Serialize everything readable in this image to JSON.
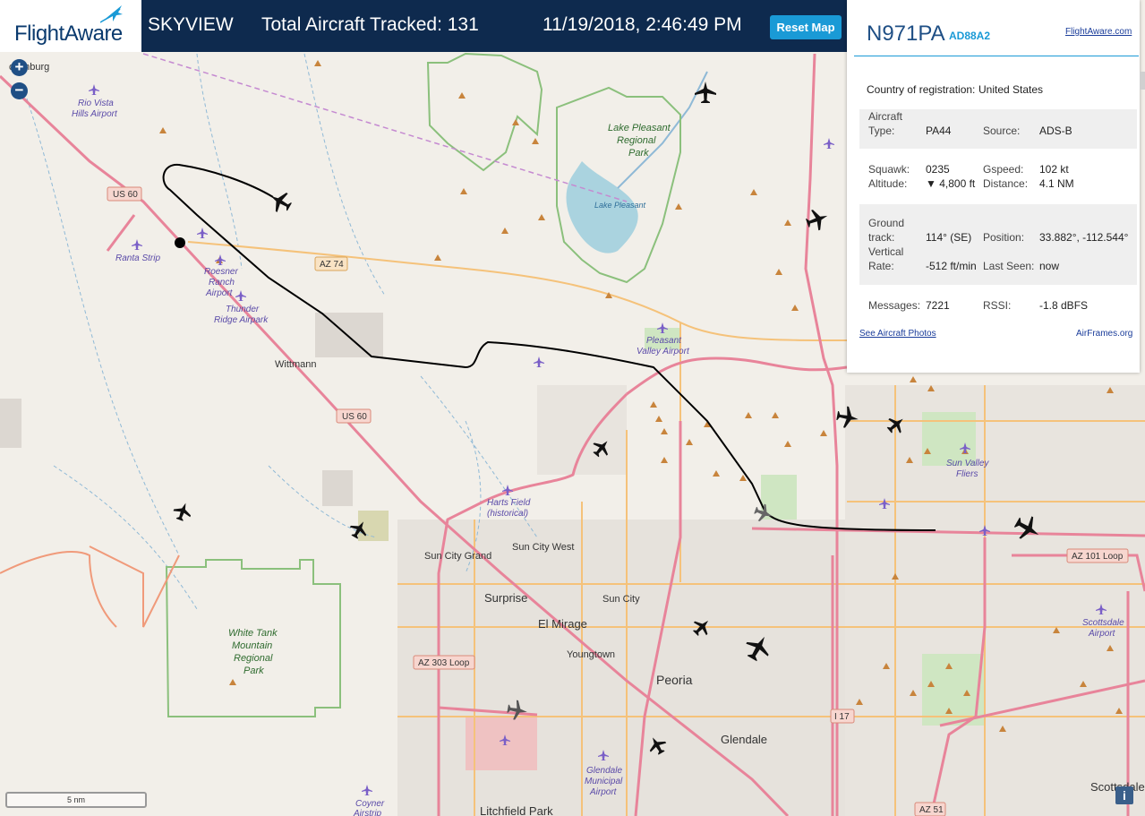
{
  "header": {
    "brand": "FlightAware",
    "app_name": "SKYVIEW",
    "tracked_label": "Total Aircraft Tracked: 131",
    "datetime": "11/19/2018, 2:46:49 PM",
    "reset_label": "Reset Map"
  },
  "map_controls": {
    "zoom_in": "+",
    "zoom_out": "−",
    "scale": "5 nm",
    "info": "i"
  },
  "aircraft": {
    "ident": "N971PA",
    "hex": "AD88A2",
    "flightaware_link": "FlightAware.com",
    "country_label": "Country of registration:",
    "country": "United States",
    "type_label_1": "Aircraft",
    "type_label_2": "Type:",
    "type": "PA44",
    "source_label": "Source:",
    "source": "ADS-B",
    "squawk_label": "Squawk:",
    "squawk": "0235",
    "gspeed_label": "Gspeed:",
    "gspeed": "102 kt",
    "altitude_label": "Altitude:",
    "altitude": "▼ 4,800 ft",
    "distance_label": "Distance:",
    "distance": "4.1 NM",
    "track_label_1": "Ground",
    "track_label_2": "track:",
    "track": "114° (SE)",
    "position_label": "Position:",
    "position": "33.882°, -112.544°",
    "vrate_label_1": "Vertical",
    "vrate_label_2": "Rate:",
    "vrate": "-512 ft/min",
    "lastseen_label": "Last Seen:",
    "lastseen": "now",
    "messages_label": "Messages:",
    "messages": "7221",
    "rssi_label": "RSSI:",
    "rssi": "-1.8 dBFS",
    "photos_link": "See Aircraft Photos",
    "airframes_link": "AirFrames.org"
  },
  "map_labels": {
    "wickenburg": "ckenburg",
    "rio_vista": "Rio Vista",
    "rio_vista2": "Hills Airport",
    "us60_a": "US 60",
    "us60_b": "US 60",
    "az74": "AZ 74",
    "ranta": "Ranta Strip",
    "roesner1": "Roesner",
    "roesner2": "Ranch",
    "roesner3": "Airport",
    "thunder1": "Thunder",
    "thunder2": "Ridge Airpark",
    "wittmann": "Wittmann",
    "lake_pleasant_park1": "Lake Pleasant",
    "lake_pleasant_park2": "Regional",
    "lake_pleasant_park3": "Park",
    "lake_pleasant": "Lake Pleasant",
    "pleasant_valley1": "Pleasant",
    "pleasant_valley2": "Valley Airport",
    "harts1": "Harts Field",
    "harts2": "(historical)",
    "sun_city_west": "Sun City West",
    "sun_city_grand": "Sun City Grand",
    "surprise": "Surprise",
    "sun_city": "Sun City",
    "el_mirage": "El Mirage",
    "youngtown": "Youngtown",
    "white_tank1": "White Tank",
    "white_tank2": "Mountain",
    "white_tank3": "Regional",
    "white_tank4": "Park",
    "az303": "AZ 303 Loop",
    "peoria": "Peoria",
    "glendale": "Glendale",
    "glendale_airport1": "Glendale",
    "glendale_airport2": "Municipal",
    "glendale_airport3": "Airport",
    "coyner1": "Coyner",
    "coyner2": "Airstrip",
    "litchfield": "Litchfield Park",
    "sun_valley1": "Sun Valley",
    "sun_valley2": "Fliers",
    "az101": "AZ 101 Loop",
    "scottsdale_airport1": "Scottsdale",
    "scottsdale_airport2": "Airport",
    "scottsdale": "Scottsdale",
    "i17": "I 17",
    "az51": "AZ 51"
  },
  "colors": {
    "header_bg": "#0e2a4e",
    "accent": "#1a9ad6",
    "map_bg": "#f2efe9",
    "highway": "#e8849a",
    "road_secondary": "#f5c27a",
    "park": "#8bc07c",
    "water": "#aad3df",
    "track": "#000000"
  }
}
